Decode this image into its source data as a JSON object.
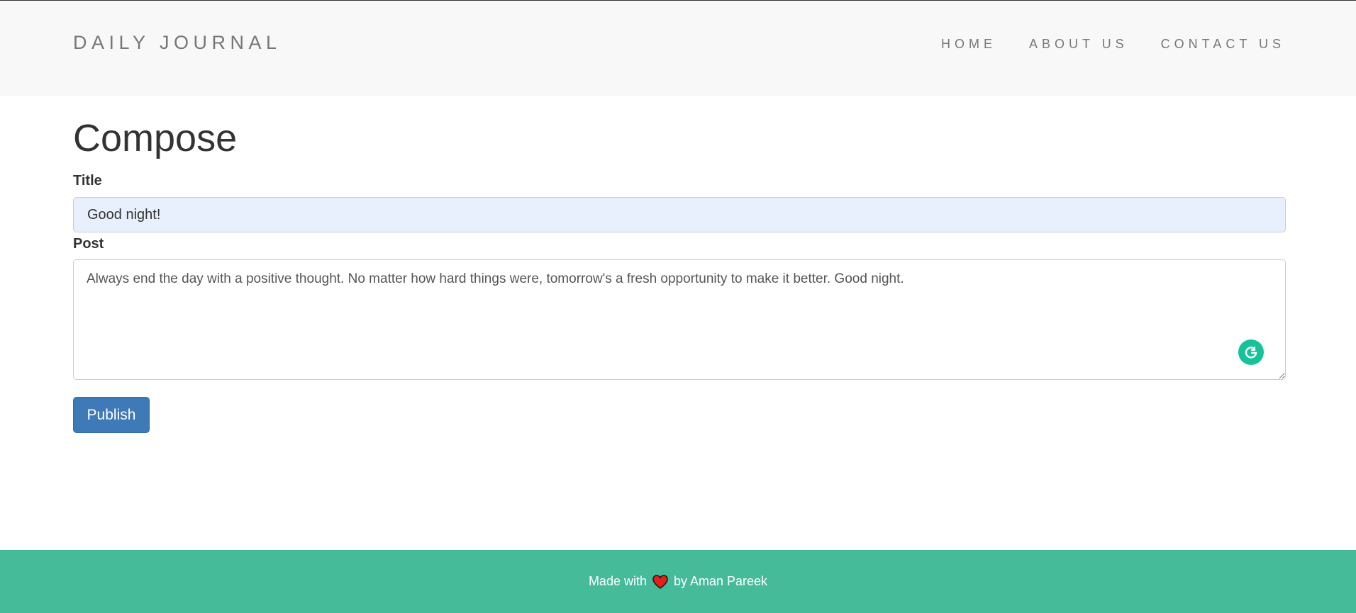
{
  "header": {
    "brand": "DAILY JOURNAL",
    "nav": [
      "HOME",
      "ABOUT US",
      "CONTACT US"
    ]
  },
  "compose": {
    "heading": "Compose",
    "title_label": "Title",
    "title_value": "Good night!",
    "post_label": "Post",
    "post_value": "Always end the day with a positive thought. No matter how hard things were, tomorrow's a fresh opportunity to make it better. Good night.",
    "publish_label": "Publish"
  },
  "footer": {
    "text_before": "Made with",
    "icon": "heart-icon",
    "text_after": "by Aman Pareek"
  },
  "colors": {
    "navbar_bg": "#f8f8f8",
    "footer_bg": "#45bb9a",
    "publish_bg": "#3f7ab8",
    "title_input_bg": "#e8f0fe",
    "grammarly": "#15c39a"
  }
}
